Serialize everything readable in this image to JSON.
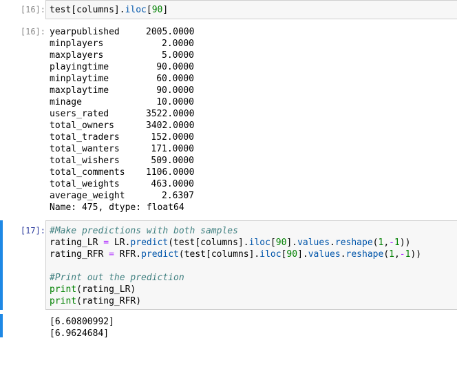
{
  "cell16": {
    "in_prompt": "[16]:",
    "out_prompt": "[16]:",
    "code": {
      "a": "test[columns].",
      "b": "iloc",
      "c": "[",
      "d": "90",
      "e": "]"
    },
    "series": [
      {
        "key": "yearpublished",
        "value": "2005.0000"
      },
      {
        "key": "minplayers",
        "value": "2.0000"
      },
      {
        "key": "maxplayers",
        "value": "5.0000"
      },
      {
        "key": "playingtime",
        "value": "90.0000"
      },
      {
        "key": "minplaytime",
        "value": "60.0000"
      },
      {
        "key": "maxplaytime",
        "value": "90.0000"
      },
      {
        "key": "minage",
        "value": "10.0000"
      },
      {
        "key": "users_rated",
        "value": "3522.0000"
      },
      {
        "key": "total_owners",
        "value": "3402.0000"
      },
      {
        "key": "total_traders",
        "value": "152.0000"
      },
      {
        "key": "total_wanters",
        "value": "171.0000"
      },
      {
        "key": "total_wishers",
        "value": "509.0000"
      },
      {
        "key": "total_comments",
        "value": "1106.0000"
      },
      {
        "key": "total_weights",
        "value": "463.0000"
      },
      {
        "key": "average_weight",
        "value": "2.6307"
      }
    ],
    "footer": "Name: 475, dtype: float64"
  },
  "cell17": {
    "in_prompt": "[17]:",
    "comment1": "#Make predictions with both samples",
    "line1": {
      "var": "rating_LR ",
      "eq": "=",
      "mid": " LR.",
      "fn": "predict",
      "a": "(test[columns].",
      "iloc": "iloc",
      "b": "[",
      "n": "90",
      "c": "].",
      "values": "values",
      "d": ".",
      "reshape": "reshape",
      "e": "(",
      "one": "1",
      "f": ",",
      "minus": "-",
      "one2": "1",
      "g": "))"
    },
    "line2": {
      "var": "rating_RFR ",
      "eq": "=",
      "mid": " RFR.",
      "fn": "predict",
      "a": "(test[columns].",
      "iloc": "iloc",
      "b": "[",
      "n": "90",
      "c": "].",
      "values": "values",
      "d": ".",
      "reshape": "reshape",
      "e": "(",
      "one": "1",
      "f": ",",
      "minus": "-",
      "one2": "1",
      "g": "))"
    },
    "comment2": "#Print out the prediction",
    "print1": {
      "fn": "print",
      "arg": "(rating_LR)"
    },
    "print2": {
      "fn": "print",
      "arg": "(rating_RFR)"
    },
    "output": [
      "[6.60800992]",
      "[6.9624684]"
    ]
  },
  "colors": {
    "selection_bar": "#1e88e5",
    "input_bg": "#f7f7f7",
    "prompt_active": "#303f9f",
    "builtin_green": "#008000",
    "number_green": "#008000",
    "operator_purple": "#aa22ff",
    "comment_teal": "#408080"
  }
}
